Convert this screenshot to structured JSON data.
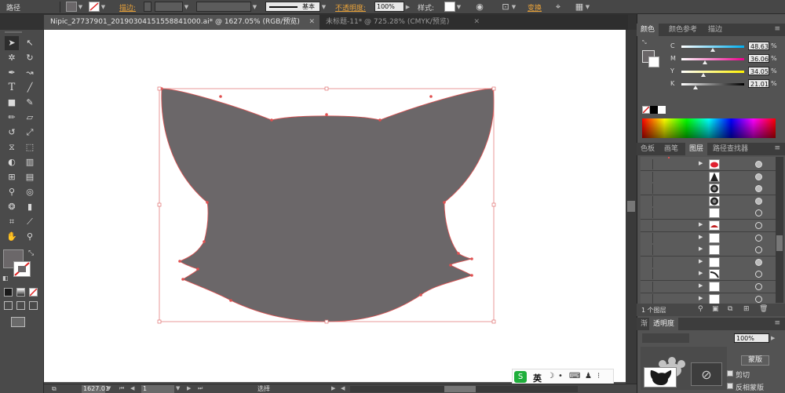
{
  "control_bar": {
    "mode_label": "路径",
    "stroke_label": "描边:",
    "stroke_style": "基本",
    "opacity_label": "不透明度:",
    "opacity_value": "100%",
    "style_label": "样式:",
    "transform_label": "变换"
  },
  "tabs": [
    {
      "label": "Nipic_27737901_20190304151558841000.ai* @ 1627.05% (RGB/预览)",
      "active": true
    },
    {
      "label": "未标题-11* @ 725.28% (CMYK/预览)",
      "active": false
    }
  ],
  "tools": {
    "icons": [
      "selection-icon",
      "direct-selection-icon",
      "magic-wand-icon",
      "lasso-icon",
      "pen-icon",
      "curvature-icon",
      "type-icon",
      "line-icon",
      "rectangle-icon",
      "paintbrush-icon",
      "pencil-icon",
      "eraser-icon",
      "rotate-icon",
      "scale-icon",
      "width-icon",
      "free-transform-icon",
      "shape-builder-icon",
      "perspective-grid-icon",
      "mesh-icon",
      "gradient-icon",
      "eyedropper-icon",
      "blend-icon",
      "symbol-sprayer-icon",
      "column-graph-icon",
      "artboard-icon",
      "slice-icon",
      "hand-icon",
      "zoom-icon"
    ]
  },
  "swatches": {
    "fill_color": "#6b6769",
    "stroke_color": "#e04848"
  },
  "shape": {
    "fill": "#6b6769",
    "stroke": "#e05050"
  },
  "color_panel": {
    "tabs": [
      "颜色",
      "颜色参考",
      "描边"
    ],
    "sliders": [
      {
        "label": "C",
        "value": "48.63",
        "unit": "%"
      },
      {
        "label": "M",
        "value": "36.06",
        "unit": "%"
      },
      {
        "label": "Y",
        "value": "34.05",
        "unit": "%"
      },
      {
        "label": "K",
        "value": "21.01",
        "unit": "%"
      }
    ]
  },
  "layers_panel": {
    "tabs": [
      "色板",
      "画笔",
      "图层",
      "路径查找器"
    ],
    "footer_label": "1 个图层"
  },
  "bottom_panel": {
    "tabs": [
      "渐",
      "透明度"
    ],
    "percent": "100%",
    "button_label": "蒙版",
    "checkboxes": [
      "剪切",
      "反相蒙版"
    ]
  },
  "status_bar": {
    "zoom": "1627.01",
    "page": "1",
    "tool_label": "选择"
  },
  "ime": {
    "label": "英"
  }
}
